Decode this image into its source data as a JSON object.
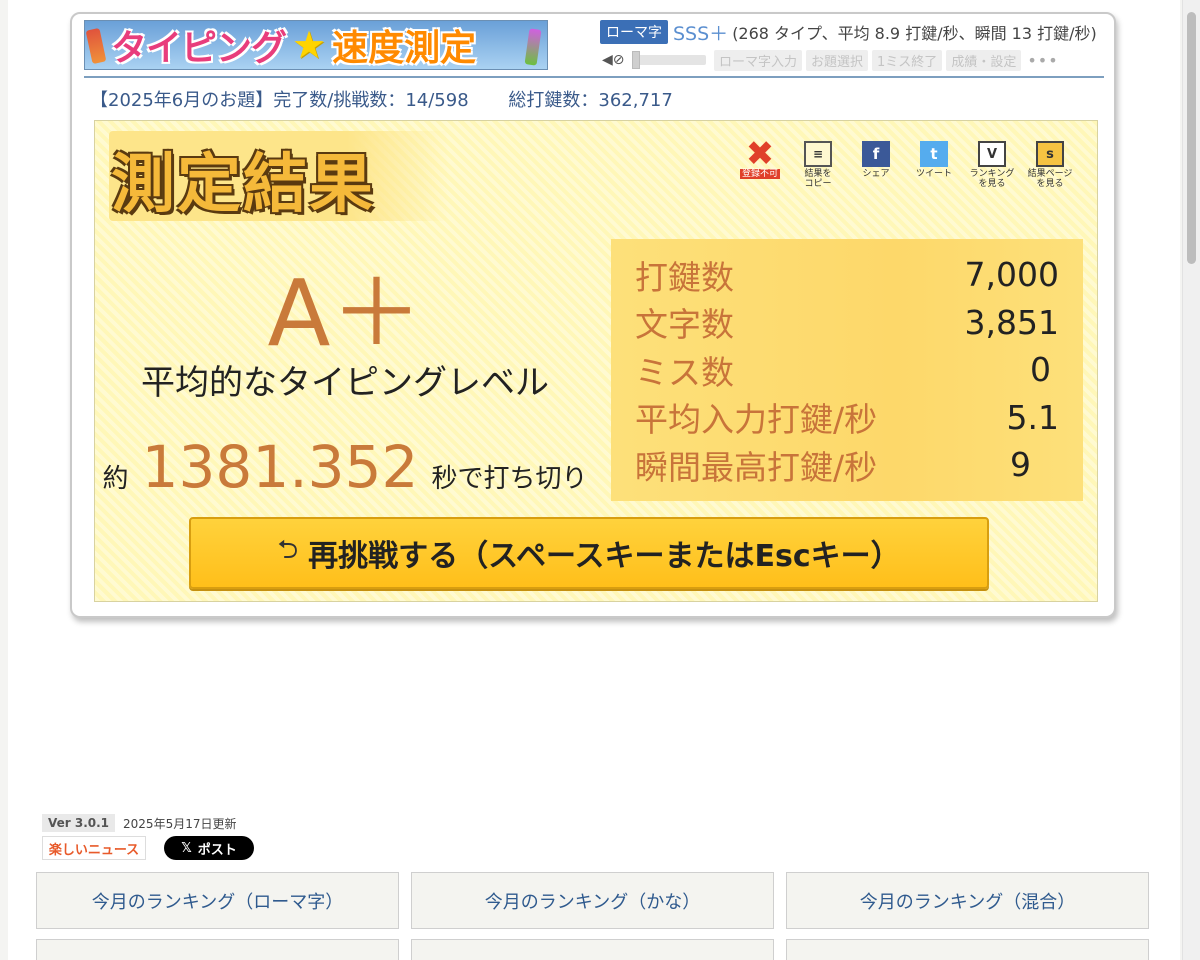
{
  "header": {
    "logo_left": "タイピング",
    "logo_right": "速度測定",
    "mode": "ローマ字",
    "rank": "SSS＋",
    "rank_detail": "(268 タイプ、平均 8.9 打鍵/秒、瞬間 13 打鍵/秒)",
    "toolbar": [
      "ローマ字入力",
      "お題選択",
      "1ミス終了",
      "成績・設定"
    ],
    "more": "•••"
  },
  "stats": {
    "topic": "【2025年6月のお題】完了数/挑戦数：14/598",
    "total": "総打鍵数：362,717"
  },
  "result": {
    "title": "測定結果",
    "icons": [
      {
        "name": "x",
        "label": "登録不可"
      },
      {
        "name": "clipboard",
        "label": "結果を\nコピー"
      },
      {
        "name": "facebook",
        "label": "シェア"
      },
      {
        "name": "twitter",
        "label": "ツイート"
      },
      {
        "name": "ranking",
        "label": "ランキング\nを見る"
      },
      {
        "name": "result-page",
        "label": "結果ページ\nを見る"
      }
    ],
    "grade": "A＋",
    "level": "平均的なタイピングレベル",
    "time_prefix": "約",
    "time_value": "1381.352",
    "time_suffix": "秒で打ち切り",
    "table": [
      {
        "label": "打鍵数",
        "value": "7,000"
      },
      {
        "label": "文字数",
        "value": "3,851"
      },
      {
        "label": "ミス数",
        "value": "0"
      },
      {
        "label": "平均入力打鍵/秒",
        "value": "5.1"
      },
      {
        "label": "瞬間最高打鍵/秒",
        "value": "9"
      }
    ],
    "retry_label": "再挑戦する（スペースキーまたはEscキー）"
  },
  "footer": {
    "version": "Ver 3.0.1",
    "updated": "2025年5月17日更新",
    "news": "楽しいニュース",
    "post": "ポスト",
    "nav": [
      "今月のランキング（ローマ字）",
      "今月のランキング（かな）",
      "今月のランキング（混合）",
      "",
      "",
      ""
    ]
  }
}
